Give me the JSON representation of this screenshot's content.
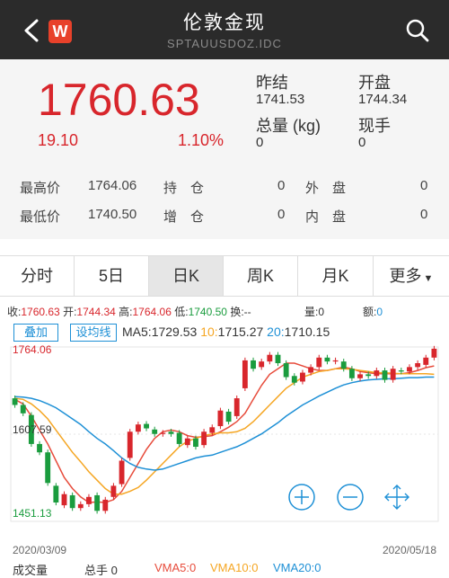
{
  "header": {
    "title": "伦敦金现",
    "subtitle": "SPTAUUSDOZ.IDC",
    "logo_text": "W"
  },
  "quote": {
    "price": "1760.63",
    "change": "19.10",
    "change_pct": "1.10%",
    "prev_close_label": "昨结",
    "prev_close": "1741.53",
    "open_label": "开盘",
    "open": "1744.34",
    "volume_label": "总量 (kg)",
    "volume": "0",
    "current_hand_label": "现手",
    "current_hand": "0",
    "high_label": "最高价",
    "high": "1764.06",
    "low_label": "最低价",
    "low": "1740.50",
    "hold_label": "持　仓",
    "hold": "0",
    "add_label": "增　仓",
    "add": "0",
    "outer_label": "外　盘",
    "outer": "0",
    "inner_label": "内　盘",
    "inner": "0"
  },
  "tabs": [
    {
      "label": "分时"
    },
    {
      "label": "5日"
    },
    {
      "label": "日K"
    },
    {
      "label": "周K"
    },
    {
      "label": "月K"
    },
    {
      "label": "更多"
    }
  ],
  "active_tab": 2,
  "info_bar": {
    "close_label": "收:",
    "close": "1760.63",
    "open_label": "开:",
    "open": "1744.34",
    "high_label": "高:",
    "high": "1764.06",
    "low_label": "低:",
    "low": "1740.50",
    "turnover_label": "换:",
    "turnover": "--",
    "vol_label": "量:",
    "vol": "0",
    "amount_label": "额:",
    "amount": "0"
  },
  "ma_bar": {
    "overlay_btn": "叠加",
    "line_btn": "设均线",
    "ma5_label": "MA5:",
    "ma5": "1729.53",
    "ma10_label": "10:",
    "ma10": "1715.27",
    "ma20_label": "20:",
    "ma20": "1710.15"
  },
  "colors": {
    "up": "#d8262c",
    "down": "#1a9c3e",
    "ma5": "#e74c3c",
    "ma10": "#f5a623",
    "ma20": "#1e90d6",
    "accent": "#1e90d6"
  },
  "chart_data": {
    "type": "candlestick",
    "y_high_label": "1764.06",
    "y_mid_label": "1607.59",
    "y_low_label": "1451.13",
    "start_date": "2020/03/09",
    "end_date": "2020/05/18",
    "ylim": [
      1451.13,
      1764.06
    ],
    "candles": [
      {
        "o": 1672,
        "c": 1660
      },
      {
        "o": 1660,
        "c": 1645
      },
      {
        "o": 1642,
        "c": 1590
      },
      {
        "o": 1590,
        "c": 1575
      },
      {
        "o": 1575,
        "c": 1520
      },
      {
        "o": 1515,
        "c": 1485
      },
      {
        "o": 1480,
        "c": 1500
      },
      {
        "o": 1498,
        "c": 1475
      },
      {
        "o": 1475,
        "c": 1482
      },
      {
        "o": 1482,
        "c": 1495
      },
      {
        "o": 1498,
        "c": 1470
      },
      {
        "o": 1470,
        "c": 1490
      },
      {
        "o": 1495,
        "c": 1515
      },
      {
        "o": 1518,
        "c": 1560
      },
      {
        "o": 1565,
        "c": 1612
      },
      {
        "o": 1612,
        "c": 1625
      },
      {
        "o": 1626,
        "c": 1618
      },
      {
        "o": 1616,
        "c": 1608
      },
      {
        "o": 1608,
        "c": 1610
      },
      {
        "o": 1612,
        "c": 1608
      },
      {
        "o": 1610,
        "c": 1590
      },
      {
        "o": 1588,
        "c": 1600
      },
      {
        "o": 1600,
        "c": 1585
      },
      {
        "o": 1588,
        "c": 1612
      },
      {
        "o": 1610,
        "c": 1620
      },
      {
        "o": 1622,
        "c": 1650
      },
      {
        "o": 1648,
        "c": 1630
      },
      {
        "o": 1640,
        "c": 1672
      },
      {
        "o": 1690,
        "c": 1740
      },
      {
        "o": 1740,
        "c": 1725
      },
      {
        "o": 1728,
        "c": 1738
      },
      {
        "o": 1738,
        "c": 1750
      },
      {
        "o": 1750,
        "c": 1735
      },
      {
        "o": 1735,
        "c": 1710
      },
      {
        "o": 1712,
        "c": 1700
      },
      {
        "o": 1702,
        "c": 1718
      },
      {
        "o": 1718,
        "c": 1728
      },
      {
        "o": 1728,
        "c": 1745
      },
      {
        "o": 1745,
        "c": 1738
      },
      {
        "o": 1738,
        "c": 1740
      },
      {
        "o": 1738,
        "c": 1725
      },
      {
        "o": 1725,
        "c": 1708
      },
      {
        "o": 1708,
        "c": 1715
      },
      {
        "o": 1715,
        "c": 1712
      },
      {
        "o": 1712,
        "c": 1722
      },
      {
        "o": 1722,
        "c": 1705
      },
      {
        "o": 1705,
        "c": 1725
      },
      {
        "o": 1722,
        "c": 1720
      },
      {
        "o": 1720,
        "c": 1728
      },
      {
        "o": 1728,
        "c": 1735
      },
      {
        "o": 1732,
        "c": 1745
      },
      {
        "o": 1745,
        "c": 1761
      }
    ],
    "ma5": [
      1670,
      1662,
      1640,
      1615,
      1590,
      1560,
      1530,
      1510,
      1495,
      1485,
      1486,
      1485,
      1490,
      1505,
      1530,
      1555,
      1580,
      1600,
      1612,
      1615,
      1612,
      1605,
      1602,
      1603,
      1605,
      1612,
      1620,
      1630,
      1645,
      1670,
      1695,
      1715,
      1725,
      1735,
      1735,
      1730,
      1725,
      1722,
      1722,
      1725,
      1728,
      1725,
      1720,
      1718,
      1716,
      1716,
      1716,
      1716,
      1718,
      1722,
      1727,
      1730
    ],
    "ma10": [
      1672,
      1670,
      1662,
      1650,
      1635,
      1615,
      1595,
      1575,
      1558,
      1540,
      1525,
      1510,
      1500,
      1500,
      1505,
      1512,
      1525,
      1540,
      1555,
      1570,
      1585,
      1595,
      1600,
      1605,
      1608,
      1610,
      1610,
      1612,
      1618,
      1630,
      1645,
      1660,
      1675,
      1690,
      1700,
      1710,
      1715,
      1720,
      1722,
      1725,
      1725,
      1724,
      1722,
      1720,
      1718,
      1718,
      1717,
      1716,
      1716,
      1716,
      1716,
      1715
    ],
    "ma20": [
      1675,
      1674,
      1672,
      1668,
      1662,
      1655,
      1645,
      1635,
      1625,
      1612,
      1600,
      1590,
      1578,
      1565,
      1555,
      1548,
      1545,
      1543,
      1545,
      1550,
      1555,
      1560,
      1565,
      1568,
      1570,
      1575,
      1580,
      1585,
      1592,
      1600,
      1608,
      1618,
      1628,
      1640,
      1650,
      1660,
      1668,
      1676,
      1683,
      1690,
      1696,
      1700,
      1703,
      1705,
      1706,
      1707,
      1707,
      1708,
      1709,
      1709,
      1710,
      1710
    ]
  },
  "bottom_bar": {
    "vol_label": "成交量",
    "total_hand_label": "总手",
    "total_hand": "0",
    "vma5_label": "VMA5:",
    "vma5": "0",
    "vma10_label": "VMA10:",
    "vma10": "0",
    "vma20_label": "VMA20:",
    "vma20": "0"
  }
}
